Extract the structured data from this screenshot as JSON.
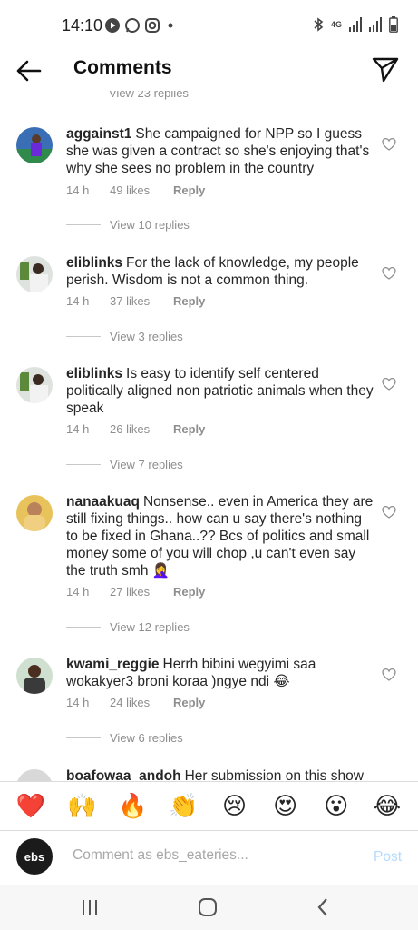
{
  "status_bar": {
    "time": "14:10",
    "network": "4G"
  },
  "header": {
    "title": "Comments"
  },
  "top_cut_replies": "View 23 replies",
  "comments": [
    {
      "username": "aggainst1",
      "text": "She campaigned for NPP so I guess she was given a contract so she's enjoying that's why she sees no problem in the country",
      "time": "14 h",
      "likes": "49 likes",
      "reply": "Reply",
      "view_replies": "View 10 replies"
    },
    {
      "username": "eliblinks",
      "text": "For the lack of knowledge, my people perish. Wisdom is not a common thing.",
      "time": "14 h",
      "likes": "37 likes",
      "reply": "Reply",
      "view_replies": "View 3 replies"
    },
    {
      "username": "eliblinks",
      "text": "Is easy to identify self centered politically aligned non patriotic animals when they  speak",
      "time": "14 h",
      "likes": "26 likes",
      "reply": "Reply",
      "view_replies": "View 7 replies"
    },
    {
      "username": "nanaakuaq",
      "text": "Nonsense.. even in America they are still fixing things.. how can u say there's nothing to be fixed in Ghana..?? Bcs of politics and small money some of you will chop ,u can't even say the truth smh 🤦‍♀️",
      "time": "14 h",
      "likes": "27 likes",
      "reply": "Reply",
      "view_replies": "View 12 replies"
    },
    {
      "username": "kwami_reggie",
      "text": "Herrh bibini wegyimi saa wokakyer3 broni koraa )ngye ndi 😂",
      "time": "14 h",
      "likes": "24 likes",
      "reply": "Reply",
      "view_replies": "View 6 replies"
    },
    {
      "username": "boafowaa_andoh",
      "text": "Her submission on this show"
    }
  ],
  "emoji_bar": [
    "❤️",
    "🙌",
    "🔥",
    "👏",
    "😢",
    "😍",
    "😮",
    "😂"
  ],
  "comment_input": {
    "avatar_text": "ebs",
    "placeholder": "Comment as ebs_eateries...",
    "post_label": "Post"
  }
}
